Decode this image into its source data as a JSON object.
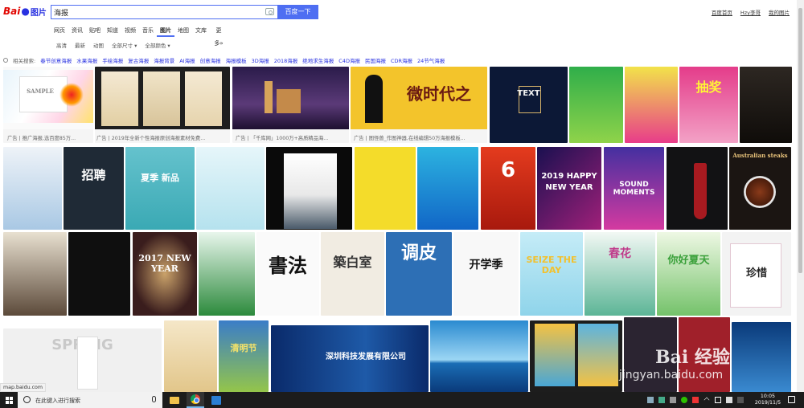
{
  "header": {
    "logo_bai": "Bai",
    "logo_du": "du",
    "logo_tupian": "图片",
    "search_value": "海报",
    "search_button": "百度一下",
    "top_links": [
      "百度首页",
      "Hzy李哥",
      "我的图片"
    ]
  },
  "tabs": [
    {
      "label": "网页"
    },
    {
      "label": "资讯"
    },
    {
      "label": "贴吧"
    },
    {
      "label": "知道"
    },
    {
      "label": "视频"
    },
    {
      "label": "音乐"
    },
    {
      "label": "图片",
      "active": true
    },
    {
      "label": "地图"
    },
    {
      "label": "文库"
    },
    {
      "label": "更多»"
    }
  ],
  "filters": [
    "高清",
    "最新",
    "动图",
    "全部尺寸 ▾",
    "全部颜色 ▾"
  ],
  "related": {
    "label": "相关搜索:",
    "items": [
      "春节创意海报",
      "水果海报",
      "手绘海报",
      "复古海报",
      "海报背景",
      "AI海报",
      "创意海报",
      "海报模板",
      "3D海报",
      "2018海报",
      "绝地求生海报",
      "C4D海报",
      "民国海报",
      "CDR海报",
      "24节气海报"
    ]
  },
  "ads": [
    "广告 | 推广海报,选百度85万...",
    "广告 | 2019年全新个性海报原创海报素材免费...",
    "广告 | 「千库网」1000万+高质精品海...",
    "广告 | 图怪兽_作图神器,在线编辑50万海报模板..."
  ],
  "poster_texts": {
    "sample": "SAMPLE",
    "weishidai": "微时代之",
    "chuangxin": "TEXT",
    "choujiang": "抽奖",
    "zhaopin": "招聘",
    "xiaji": "夏季 新品",
    "six": "6",
    "year2019": "2019 HAPPY NEW YEAR",
    "sound": "SOUND MOMENTS",
    "steaks": "Australian steaks",
    "year2017": "2017 NEW YEAR",
    "shufa": "書法",
    "zhubaishi": "築白室",
    "tiaopi": "调皮",
    "kaixue": "开学季",
    "seize": "SEIZE THE DAY",
    "chunhua": "春花",
    "nihao": "你好夏天",
    "zhenxi": "珍惜",
    "spring": "SPRING",
    "qingming": "清明节",
    "tech": "深圳科技发展有限公司"
  },
  "status_url": "map.baidu.com",
  "watermark": {
    "brand": "Bai 经验",
    "url": "jingyan.baidu.com"
  },
  "taskbar": {
    "search_placeholder": "在此键入进行搜索",
    "time": "10:05",
    "date": "2019/11/5"
  }
}
